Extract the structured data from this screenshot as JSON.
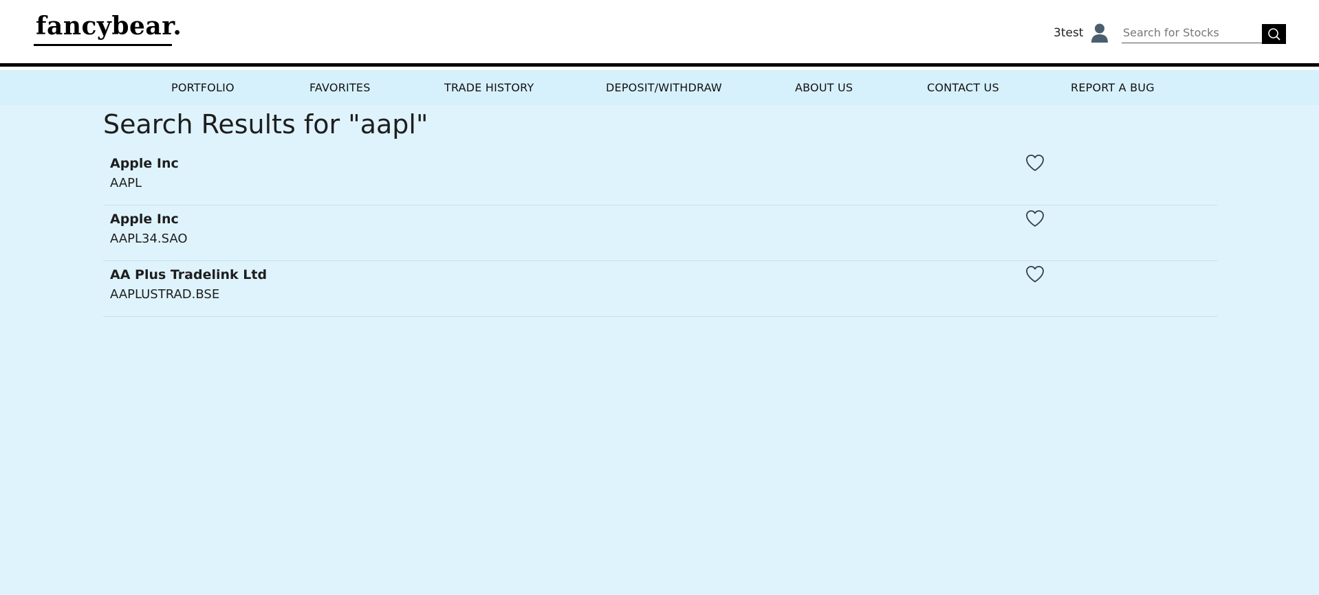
{
  "header": {
    "logo_text": "fancybear.",
    "username": "3test",
    "user_icon": "user-icon",
    "search": {
      "placeholder": "Search for Stocks",
      "value": "",
      "button_icon": "search-icon"
    }
  },
  "nav": {
    "items": [
      {
        "label": "PORTFOLIO"
      },
      {
        "label": "FAVORITES"
      },
      {
        "label": "TRADE HISTORY"
      },
      {
        "label": "DEPOSIT/WITHDRAW"
      },
      {
        "label": "ABOUT US"
      },
      {
        "label": "CONTACT US"
      },
      {
        "label": "REPORT A BUG"
      }
    ]
  },
  "main": {
    "title": "Search Results for \"aapl\"",
    "results": [
      {
        "name": "Apple Inc",
        "symbol": "AAPL",
        "fav_icon": "heart-icon"
      },
      {
        "name": "Apple Inc",
        "symbol": "AAPL34.SAO",
        "fav_icon": "heart-icon"
      },
      {
        "name": "AA Plus Tradelink Ltd",
        "symbol": "AAPLUSTRAD.BSE",
        "fav_icon": "heart-icon"
      }
    ]
  },
  "colors": {
    "nav_bg": "#d6f1fc",
    "page_bg": "#dff3fc",
    "header_border": "#000000",
    "text": "#1e1e1e",
    "search_button_bg": "#000000"
  }
}
